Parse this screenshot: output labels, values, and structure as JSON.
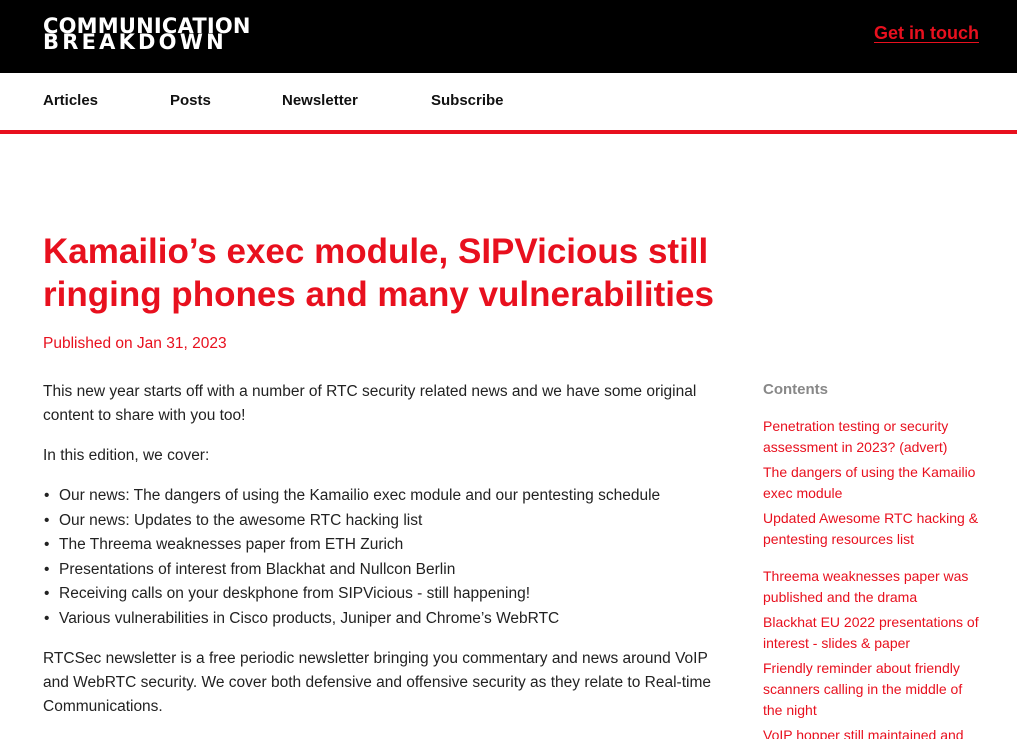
{
  "header": {
    "logo_line1": "Communication",
    "logo_line2": "Breakdown",
    "cta": "Get in touch"
  },
  "nav": {
    "items": [
      "Articles",
      "Posts",
      "Newsletter",
      "Subscribe"
    ]
  },
  "article": {
    "title": "Kamailio’s exec module, SIPVicious still ringing phones and many vulnerabilities",
    "published": "Published on Jan 31, 2023",
    "intro": "This new year starts off with a number of RTC security related news and we have some original content to share with you too!",
    "cover_lead": "In this edition, we cover:",
    "bullets": [
      "Our news: The dangers of using the Kamailio exec module and our pentesting schedule",
      "Our news: Updates to the awesome RTC hacking list",
      "The Threema weaknesses paper from ETH Zurich",
      "Presentations of interest from Blackhat and Nullcon Berlin",
      "Receiving calls on your deskphone from SIPVicious - still happening!",
      "Various vulnerabilities in Cisco products, Juniper and Chrome’s WebRTC"
    ],
    "outro": "RTCSec newsletter is a free periodic newsletter bringing you commentary and news around VoIP and WebRTC security. We cover both defensive and offensive security as they relate to Real-time Communications."
  },
  "toc": {
    "title": "Contents",
    "items": [
      "Penetration testing or security assessment in 2023? (advert)",
      "The dangers of using the Kamailio exec module",
      "Updated Awesome RTC hacking & pentesting resources list",
      "Threema weaknesses paper was published and the drama",
      "Blackhat EU 2022 presentations of interest - slides & paper",
      "Friendly reminder about friendly scanners calling in the middle of the night",
      "VoIP hopper still maintained and"
    ]
  },
  "colors": {
    "accent": "#e8101e",
    "header_bg": "#000000",
    "text": "#222222",
    "muted": "#888888"
  }
}
